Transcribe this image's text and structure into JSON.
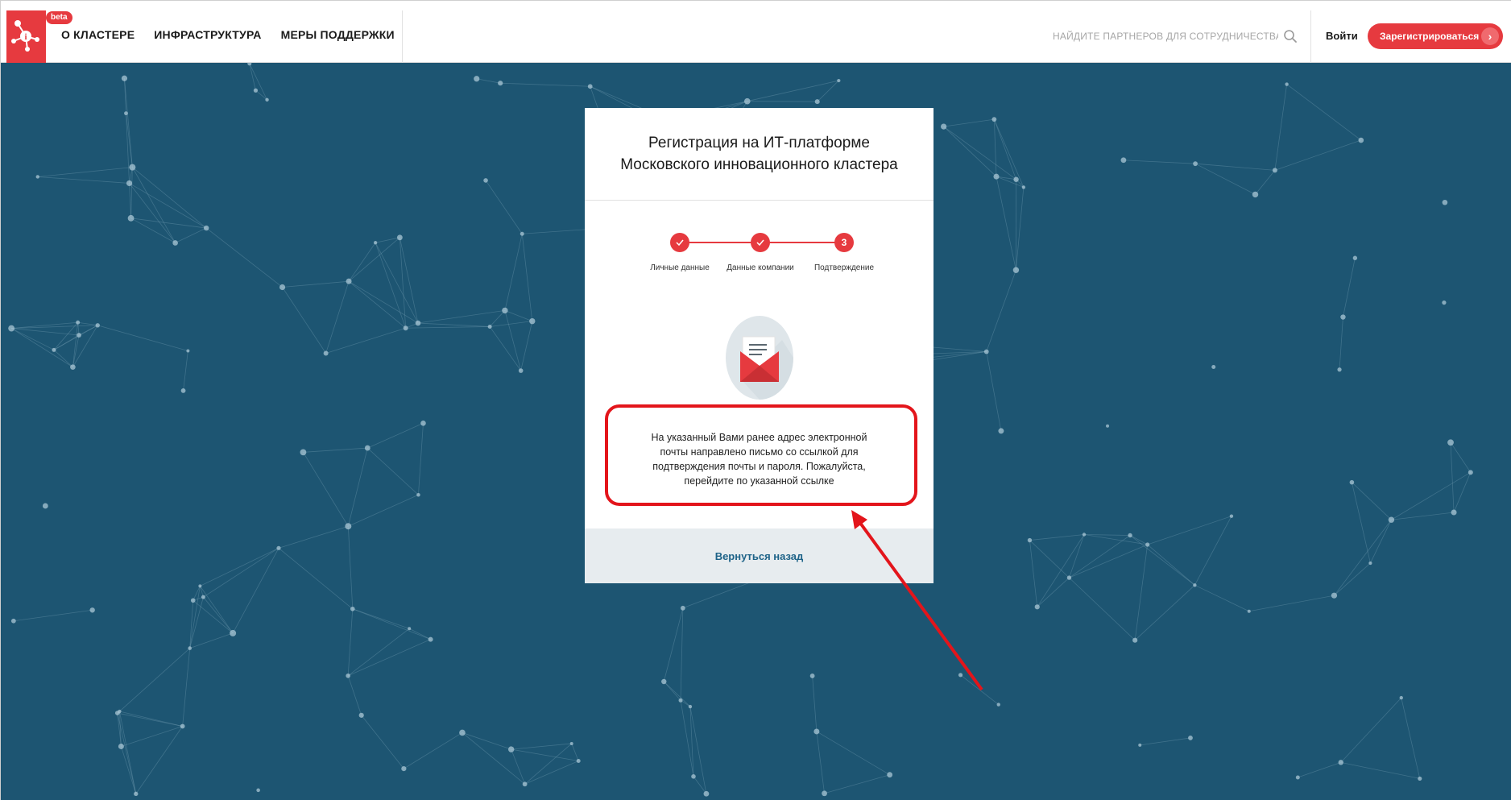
{
  "header": {
    "logo_name": "cluster-network-logo",
    "beta_label": "beta",
    "nav": [
      {
        "label": "О КЛАСТЕРЕ"
      },
      {
        "label": "ИНФРАСТРУКТУРА"
      },
      {
        "label": "МЕРЫ ПОДДЕРЖКИ"
      }
    ],
    "search": {
      "placeholder": "НАЙДИТЕ ПАРТНЕРОВ ДЛЯ СОТРУДНИЧЕСТВА",
      "icon": "search-icon"
    },
    "login_label": "Войти",
    "register_label": "Зарегистрироваться",
    "register_icon": "chevron-right-icon"
  },
  "card": {
    "title_line1": "Регистрация на ИТ-платформе",
    "title_line2": "Московского инновационного кластера",
    "steps": [
      {
        "label": "Личные данные",
        "status": "done",
        "icon": "checkmark-icon"
      },
      {
        "label": "Данные компании",
        "status": "done",
        "icon": "checkmark-icon"
      },
      {
        "label": "Подтверждение",
        "status": "current",
        "number": "3"
      }
    ],
    "illustration": "envelope-letter-icon",
    "message_lines": [
      "На указанный Вами ранее адрес электронной",
      "почты направлено письмо со ссылкой для",
      "подтверждения почты и пароля. Пожалуйста,",
      "перейдите по указанной ссылке"
    ],
    "back_label": "Вернуться назад"
  },
  "colors": {
    "accent": "#e63a3f",
    "background": "#1d5572",
    "annotation": "#e3151b",
    "link": "#1e6388"
  }
}
